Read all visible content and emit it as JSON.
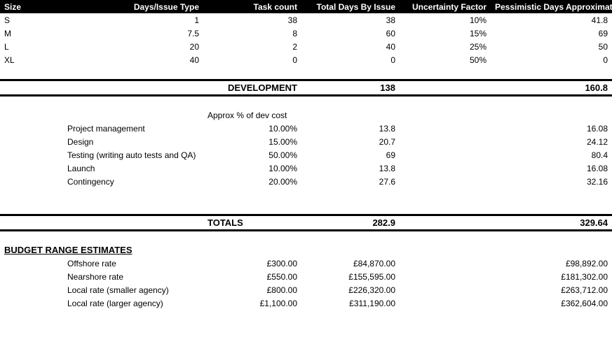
{
  "headers": {
    "size": "Size",
    "days": "Days/Issue Type",
    "tasks": "Task count",
    "total_days": "Total Days By Issue",
    "uncertainty": "Uncertainty Factor",
    "pessimistic": "Pessimistic Days Approximation"
  },
  "size_rows": [
    {
      "size": "S",
      "days": "1",
      "tasks": "38",
      "total": "38",
      "unc": "10%",
      "pess": "41.8"
    },
    {
      "size": "M",
      "days": "7.5",
      "tasks": "8",
      "total": "60",
      "unc": "15%",
      "pess": "69"
    },
    {
      "size": "L",
      "days": "20",
      "tasks": "2",
      "total": "40",
      "unc": "25%",
      "pess": "50"
    },
    {
      "size": "XL",
      "days": "40",
      "tasks": "0",
      "total": "0",
      "unc": "50%",
      "pess": "0"
    }
  ],
  "dev": {
    "label": "DEVELOPMENT",
    "total": "138",
    "pess": "160.8"
  },
  "approx_label": "Approx % of dev cost",
  "cost_rows": [
    {
      "name": "Project management",
      "pct": "10.00%",
      "days": "13.8",
      "pess": "16.08"
    },
    {
      "name": "Design",
      "pct": "15.00%",
      "days": "20.7",
      "pess": "24.12"
    },
    {
      "name": "Testing (writing auto tests and QA)",
      "pct": "50.00%",
      "days": "69",
      "pess": "80.4"
    },
    {
      "name": "Launch",
      "pct": "10.00%",
      "days": "13.8",
      "pess": "16.08"
    },
    {
      "name": "Contingency",
      "pct": "20.00%",
      "days": "27.6",
      "pess": "32.16"
    }
  ],
  "totals": {
    "label": "TOTALS",
    "days": "282.9",
    "pess": "329.64"
  },
  "budget": {
    "heading": "BUDGET RANGE ESTIMATES",
    "rows": [
      {
        "name": "Offshore rate",
        "rate": "£300.00",
        "low": "£84,870.00",
        "high": "£98,892.00"
      },
      {
        "name": "Nearshore rate",
        "rate": "£550.00",
        "low": "£155,595.00",
        "high": "£181,302.00"
      },
      {
        "name": "Local rate (smaller agency)",
        "rate": "£800.00",
        "low": "£226,320.00",
        "high": "£263,712.00"
      },
      {
        "name": "Local rate (larger agency)",
        "rate": "£1,100.00",
        "low": "£311,190.00",
        "high": "£362,604.00"
      }
    ]
  }
}
